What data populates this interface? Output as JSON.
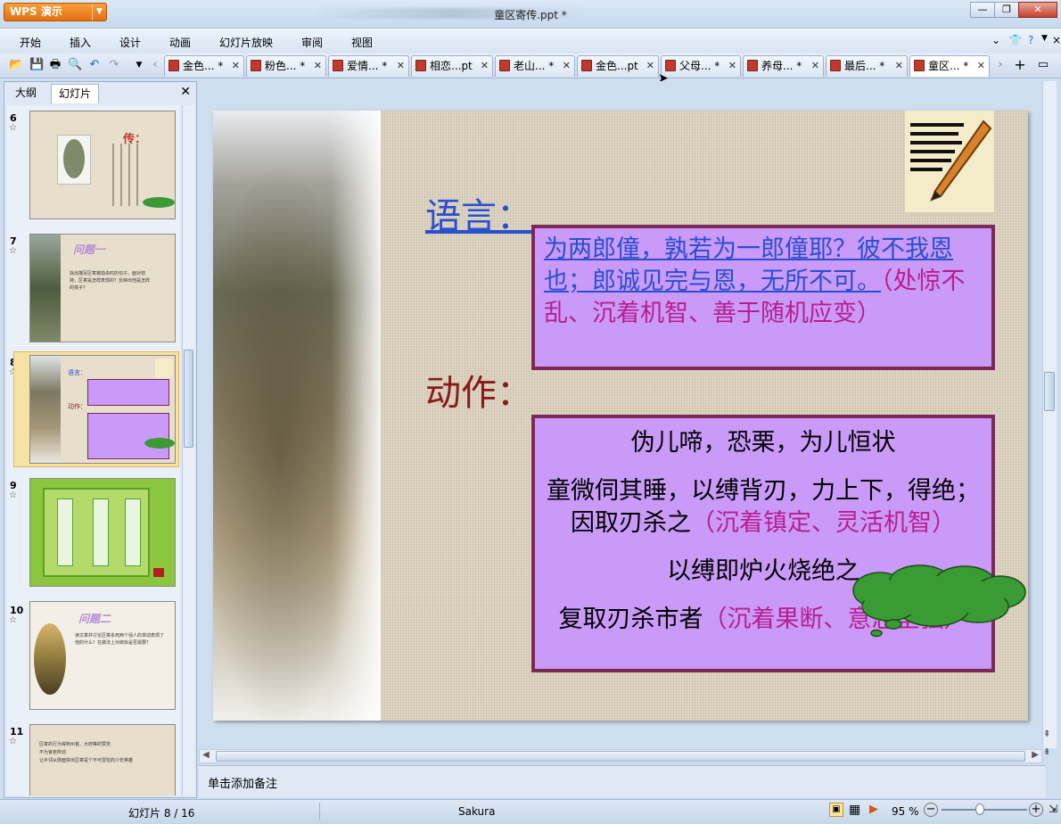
{
  "window": {
    "app_label": "WPS 演示",
    "title": "童区寄传.ppt *"
  },
  "menu": {
    "items": [
      "开始",
      "插入",
      "设计",
      "动画",
      "幻灯片放映",
      "审阅",
      "视图"
    ]
  },
  "tabs": [
    {
      "label": "金色... *"
    },
    {
      "label": "粉色... *"
    },
    {
      "label": "爱情... *"
    },
    {
      "label": "相恋...pt"
    },
    {
      "label": "老山... *"
    },
    {
      "label": "金色...pt"
    },
    {
      "label": "父母... *"
    },
    {
      "label": "养母... *"
    },
    {
      "label": "最后... *"
    },
    {
      "label": "童区... *"
    }
  ],
  "left_panel": {
    "tab_outline": "大纲",
    "tab_slides": "幻灯片",
    "thumbs": [
      {
        "num": "6"
      },
      {
        "num": "7",
        "title": "问题一",
        "text": "找出描写区寄被劫杀时的句子。面对劫持，区寄是怎样表现的？反映出他是怎样的孩子？"
      },
      {
        "num": "8",
        "selected": true
      },
      {
        "num": "9"
      },
      {
        "num": "10",
        "title": "问题二",
        "text": "读文章并讨论区寄杀死两个强人的举动表现了他的什么？在做法上对郎侩是否需要？"
      },
      {
        "num": "11",
        "lines": [
          "区寄的行为得到州官、大府等的赞赏",
          "不为官吏所动",
          "让乡邻从侧面突出区寄是个不可冒犯的少年英雄"
        ]
      }
    ],
    "thumb6_title": "传："
  },
  "slide": {
    "label_speech": "语言：",
    "speech_underlined": "为两郎僮，孰若为一郎僮耶？彼不我恩也；郎诚见完与恩，无所不可。",
    "speech_comment": "（处惊不乱、沉着机智、善于随机应变）",
    "label_action": "动作：",
    "action_1": "伪儿啼，恐栗，为儿恒状",
    "action_2": "童微伺其睡，以缚背刃，力上下，得绝；因取刃杀之",
    "action_2_comment": "（沉着镇定、灵活机智）",
    "action_3": "以缚即炉火烧绝之",
    "action_4": "复取刃杀市者",
    "action_4_comment": "（沉着果断、意志坚强）"
  },
  "notes_placeholder": "单击添加备注",
  "status": {
    "slide_counter": "幻灯片 8 / 16",
    "theme": "Sakura",
    "zoom": "95 %"
  }
}
